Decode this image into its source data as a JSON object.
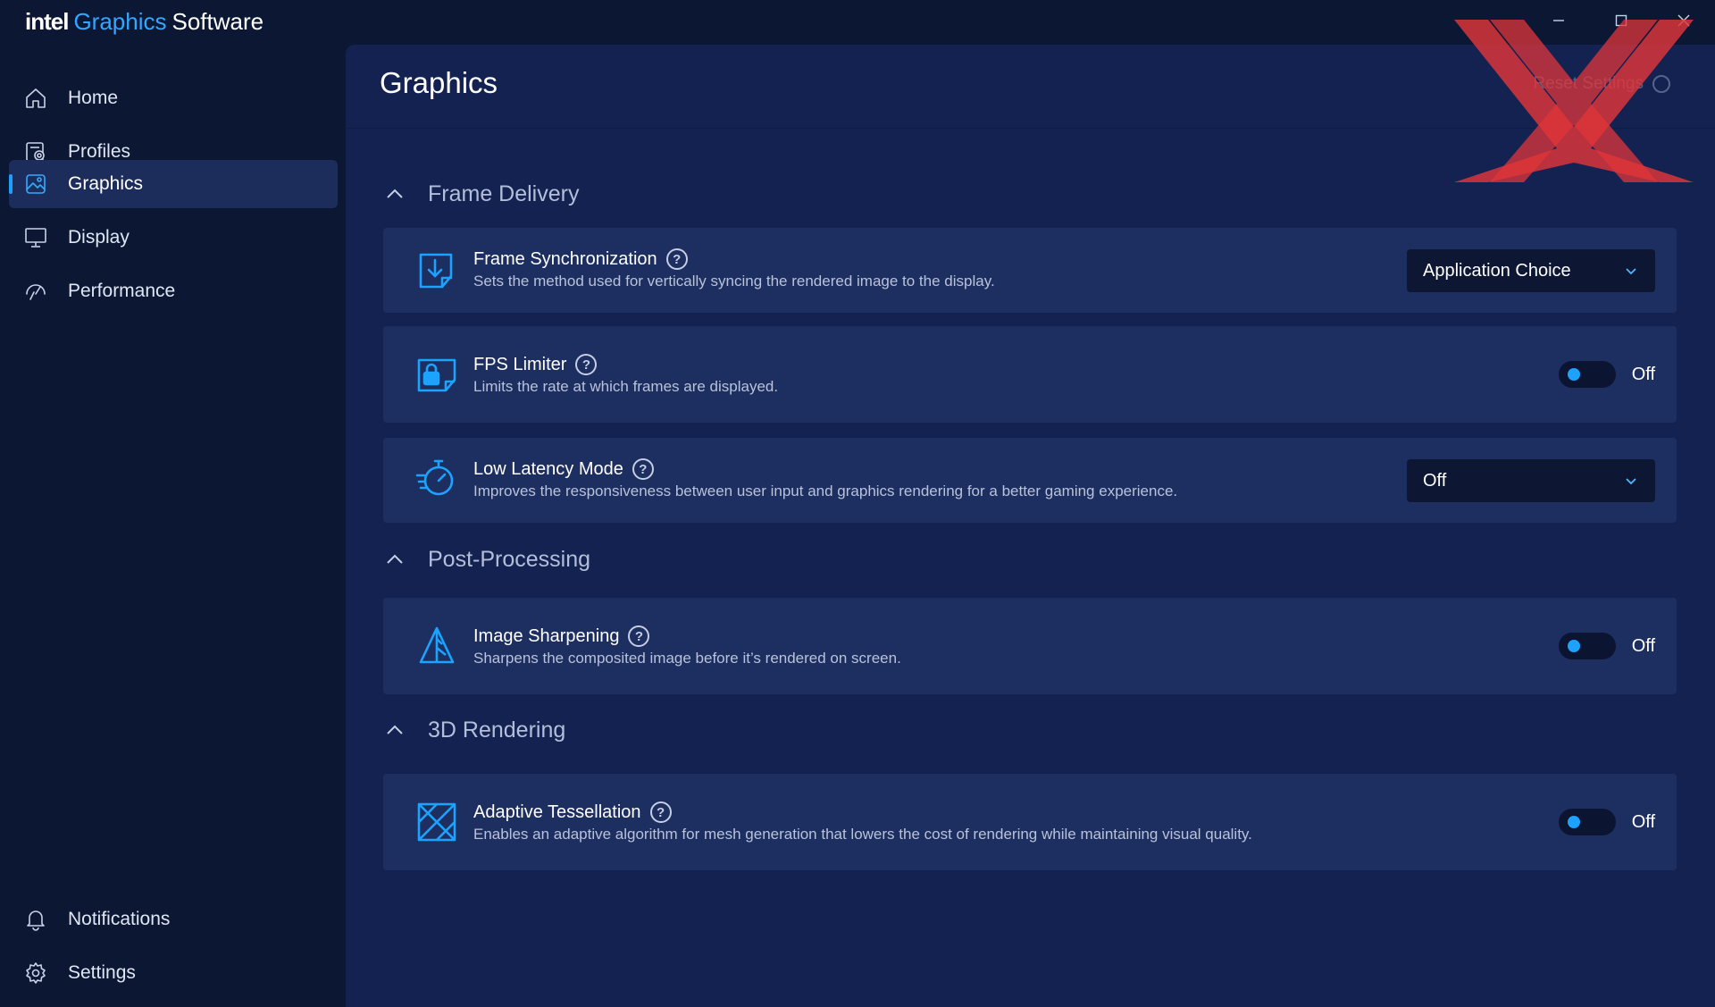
{
  "app": {
    "brand_intel": "intel",
    "brand_graphics": "Graphics",
    "brand_software": "Software"
  },
  "window_controls": {
    "minimize_icon": "minimize-icon",
    "maximize_icon": "maximize-icon",
    "close_icon": "close-icon"
  },
  "sidebar": {
    "items": [
      {
        "label": "Home",
        "icon": "home-icon"
      },
      {
        "label": "Profiles",
        "icon": "profiles-icon"
      },
      {
        "label": "Graphics",
        "icon": "graphics-icon",
        "active": true
      },
      {
        "label": "Display",
        "icon": "monitor-icon"
      },
      {
        "label": "Performance",
        "icon": "performance-icon"
      }
    ],
    "bottom_items": [
      {
        "label": "Notifications",
        "icon": "bell-icon"
      },
      {
        "label": "Settings",
        "icon": "gear-icon"
      }
    ]
  },
  "main": {
    "title": "Graphics",
    "reset_label": "Reset Settings",
    "sections": [
      {
        "title": "Frame Delivery",
        "settings": [
          {
            "title": "Frame Synchronization",
            "description": "Sets the method used for vertically syncing the rendered image to the display.",
            "control": "dropdown",
            "value": "Application Choice",
            "icon": "frame-sync-icon"
          },
          {
            "title": "FPS Limiter",
            "description": "Limits the rate at which frames are displayed.",
            "control": "toggle",
            "value": "Off",
            "icon": "fps-lock-icon"
          },
          {
            "title": "Low Latency Mode",
            "description": "Improves the responsiveness between user input and graphics rendering for a better gaming experience.",
            "control": "dropdown",
            "value": "Off",
            "icon": "stopwatch-icon"
          }
        ]
      },
      {
        "title": "Post-Processing",
        "settings": [
          {
            "title": "Image Sharpening",
            "description": "Sharpens the composited image before it’s rendered on screen.",
            "control": "toggle",
            "value": "Off",
            "icon": "sharpening-icon"
          }
        ]
      },
      {
        "title": "3D Rendering",
        "settings": [
          {
            "title": "Adaptive Tessellation",
            "description": "Enables an adaptive algorithm for mesh generation that lowers the cost of rendering while maintaining visual quality.",
            "control": "toggle",
            "value": "Off",
            "icon": "tessellation-icon"
          }
        ]
      }
    ]
  },
  "help_glyph": "?",
  "colors": {
    "accent": "#1ba3ff",
    "sidebar_bg": "#0c1734",
    "main_bg": "#132250",
    "card_bg": "#1d2e60",
    "watermark": "#e0363a"
  }
}
